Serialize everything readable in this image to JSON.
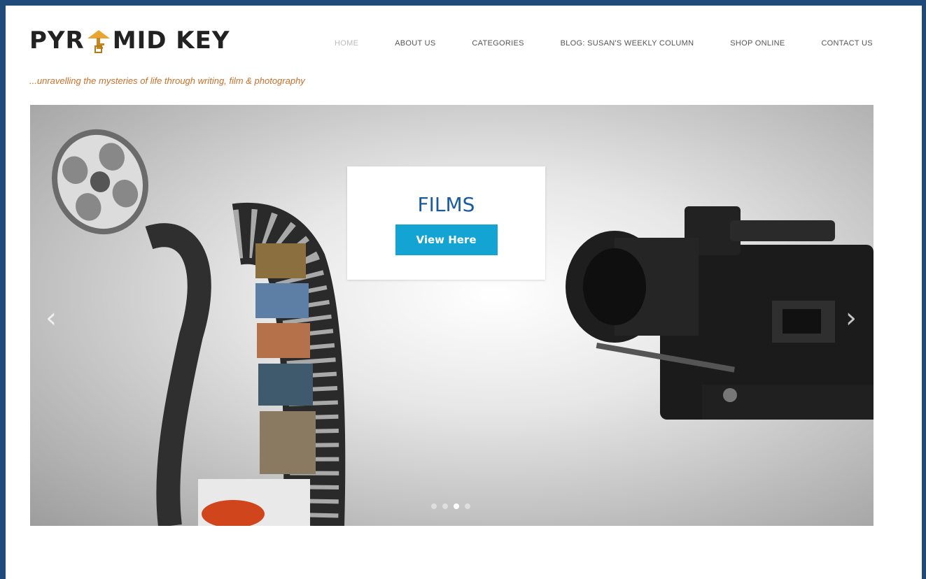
{
  "brand": {
    "logo_left": "PYR",
    "logo_right": "MID KEY",
    "tagline": "...unravelling the mysteries of life through writing, film & photography"
  },
  "nav": {
    "items": [
      {
        "label": "HOME",
        "active": true
      },
      {
        "label": "ABOUT US",
        "active": false
      },
      {
        "label": "CATEGORIES",
        "active": false
      },
      {
        "label": "BLOG: SUSAN'S WEEKLY COLUMN",
        "active": false
      },
      {
        "label": "SHOP ONLINE",
        "active": false
      },
      {
        "label": "CONTACT US",
        "active": false
      }
    ]
  },
  "slider": {
    "caption_title": "FILMS",
    "button_label": "View Here",
    "prev_icon": "‹",
    "next_icon": "›",
    "slide_count": 4,
    "active_slide": 3
  },
  "colors": {
    "frame": "#1f4a7a",
    "title": "#1a5a9e",
    "button": "#14a4d3",
    "tagline": "#c9702a"
  }
}
